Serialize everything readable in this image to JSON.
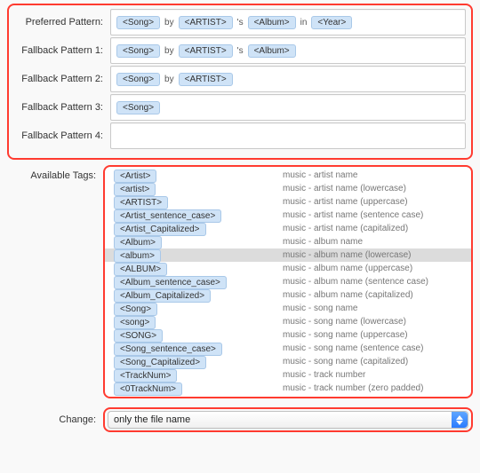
{
  "patterns": {
    "preferred": {
      "label": "Preferred Pattern:",
      "tokens": [
        "<Song>",
        "by",
        "<ARTIST>",
        "'s",
        "<Album>",
        "in",
        "<Year>"
      ]
    },
    "fallback1": {
      "label": "Fallback Pattern 1:",
      "tokens": [
        "<Song>",
        "by",
        "<ARTIST>",
        "'s",
        "<Album>"
      ]
    },
    "fallback2": {
      "label": "Fallback Pattern 2:",
      "tokens": [
        "<Song>",
        "by",
        "<ARTIST>"
      ]
    },
    "fallback3": {
      "label": "Fallback Pattern 3:",
      "tokens": [
        "<Song>"
      ]
    },
    "fallback4": {
      "label": "Fallback Pattern 4:",
      "tokens": []
    }
  },
  "tags": {
    "label": "Available Tags:",
    "items": [
      {
        "tag": "<Artist>",
        "desc": "music - artist name",
        "selected": false
      },
      {
        "tag": "<artist>",
        "desc": "music - artist name (lowercase)",
        "selected": false
      },
      {
        "tag": "<ARTIST>",
        "desc": "music - artist name (uppercase)",
        "selected": false
      },
      {
        "tag": "<Artist_sentence_case>",
        "desc": "music - artist name (sentence case)",
        "selected": false
      },
      {
        "tag": "<Artist_Capitalized>",
        "desc": "music - artist name (capitalized)",
        "selected": false
      },
      {
        "tag": "<Album>",
        "desc": "music - album name",
        "selected": false
      },
      {
        "tag": "<album>",
        "desc": "music - album name (lowercase)",
        "selected": true
      },
      {
        "tag": "<ALBUM>",
        "desc": "music - album name (uppercase)",
        "selected": false
      },
      {
        "tag": "<Album_sentence_case>",
        "desc": "music - album name (sentence case)",
        "selected": false
      },
      {
        "tag": "<Album_Capitalized>",
        "desc": "music - album name (capitalized)",
        "selected": false
      },
      {
        "tag": "<Song>",
        "desc": "music - song name",
        "selected": false
      },
      {
        "tag": "<song>",
        "desc": "music - song name (lowercase)",
        "selected": false
      },
      {
        "tag": "<SONG>",
        "desc": "music - song name (uppercase)",
        "selected": false
      },
      {
        "tag": "<Song_sentence_case>",
        "desc": "music - song name (sentence case)",
        "selected": false
      },
      {
        "tag": "<Song_Capitalized>",
        "desc": "music - song name (capitalized)",
        "selected": false
      },
      {
        "tag": "<TrackNum>",
        "desc": "music - track number",
        "selected": false
      },
      {
        "tag": "<0TrackNum>",
        "desc": "music - track number (zero padded)",
        "selected": false
      }
    ]
  },
  "change": {
    "label": "Change:",
    "value": "only the file name"
  }
}
